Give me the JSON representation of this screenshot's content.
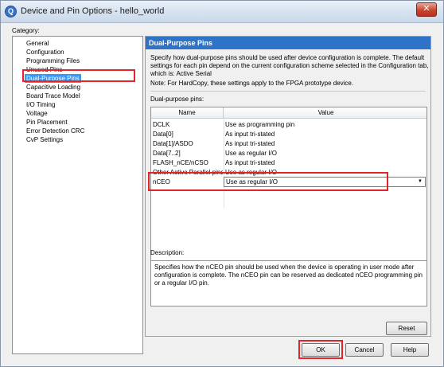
{
  "window": {
    "title": "Device and Pin Options - hello_world",
    "close_glyph": "✕"
  },
  "category": {
    "label": "Category:",
    "items": [
      "General",
      "Configuration",
      "Programming Files",
      "Unused Pins",
      "Dual-Purpose Pins",
      "Capacitive Loading",
      "Board Trace Model",
      "I/O Timing",
      "Voltage",
      "Pin Placement",
      "Error Detection CRC",
      "CvP Settings"
    ],
    "selected_index": 4
  },
  "panel": {
    "header": "Dual-Purpose Pins",
    "description": "Specify how dual-purpose pins should be used after device configuration is complete. The default settings for each pin depend on the current configuration scheme selected in the Configuration tab, which is:  Active Serial",
    "note": "Note: For HardCopy, these settings apply to the FPGA prototype device.",
    "pins_label": "Dual-purpose pins:",
    "columns": {
      "name": "Name",
      "value": "Value"
    },
    "rows": [
      {
        "name": "DCLK",
        "value": "Use as programming pin"
      },
      {
        "name": "Data[0]",
        "value": "As input tri-stated"
      },
      {
        "name": "Data[1]/ASDO",
        "value": "As input tri-stated"
      },
      {
        "name": "Data[7..2]",
        "value": "Use as regular I/O"
      },
      {
        "name": "FLASH_nCE/nCSO",
        "value": "As input tri-stated"
      },
      {
        "name": "Other Active Parallel pins",
        "value": "Use as regular I/O"
      },
      {
        "name": "nCEO",
        "value": "Use as regular I/O"
      }
    ],
    "dropdown_arrow": "▼",
    "desc_label": "Description:",
    "desc_text": "Specifies how the nCEO pin should be used when the device is operating in user mode after configuration is complete. The nCEO pin can be reserved as dedicated nCEO programming pin or a regular I/O pin.",
    "reset_label": "Reset"
  },
  "buttons": {
    "ok": "OK",
    "cancel": "Cancel",
    "help": "Help"
  },
  "icons": {
    "app_icon": "Q",
    "app_icon_name": "quartus-app-icon"
  },
  "colors": {
    "selection": "#3399ff",
    "header": "#2f73c9",
    "highlight": "#e0262a"
  }
}
